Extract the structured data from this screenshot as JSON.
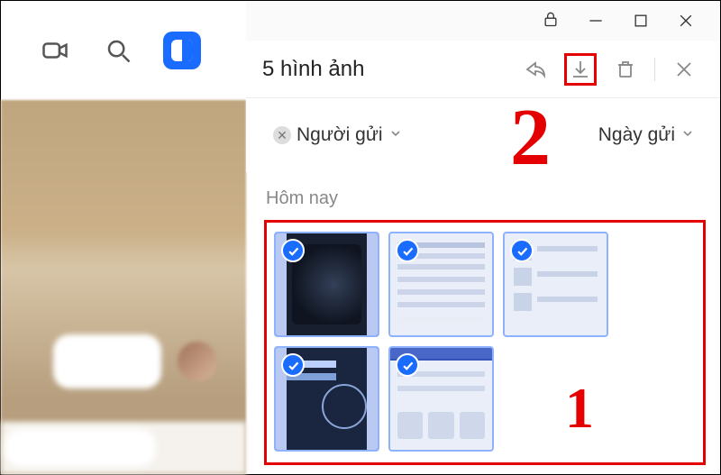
{
  "header": {
    "title": "5 hình ảnh"
  },
  "filters": {
    "sender_label": "Người gửi",
    "date_label": "Ngày gửi"
  },
  "section": {
    "today": "Hôm nay"
  },
  "annotations": {
    "step1": "1",
    "step2": "2"
  },
  "thumbnails": [
    {
      "selected": true
    },
    {
      "selected": true
    },
    {
      "selected": true
    },
    {
      "selected": true
    },
    {
      "selected": true
    }
  ]
}
